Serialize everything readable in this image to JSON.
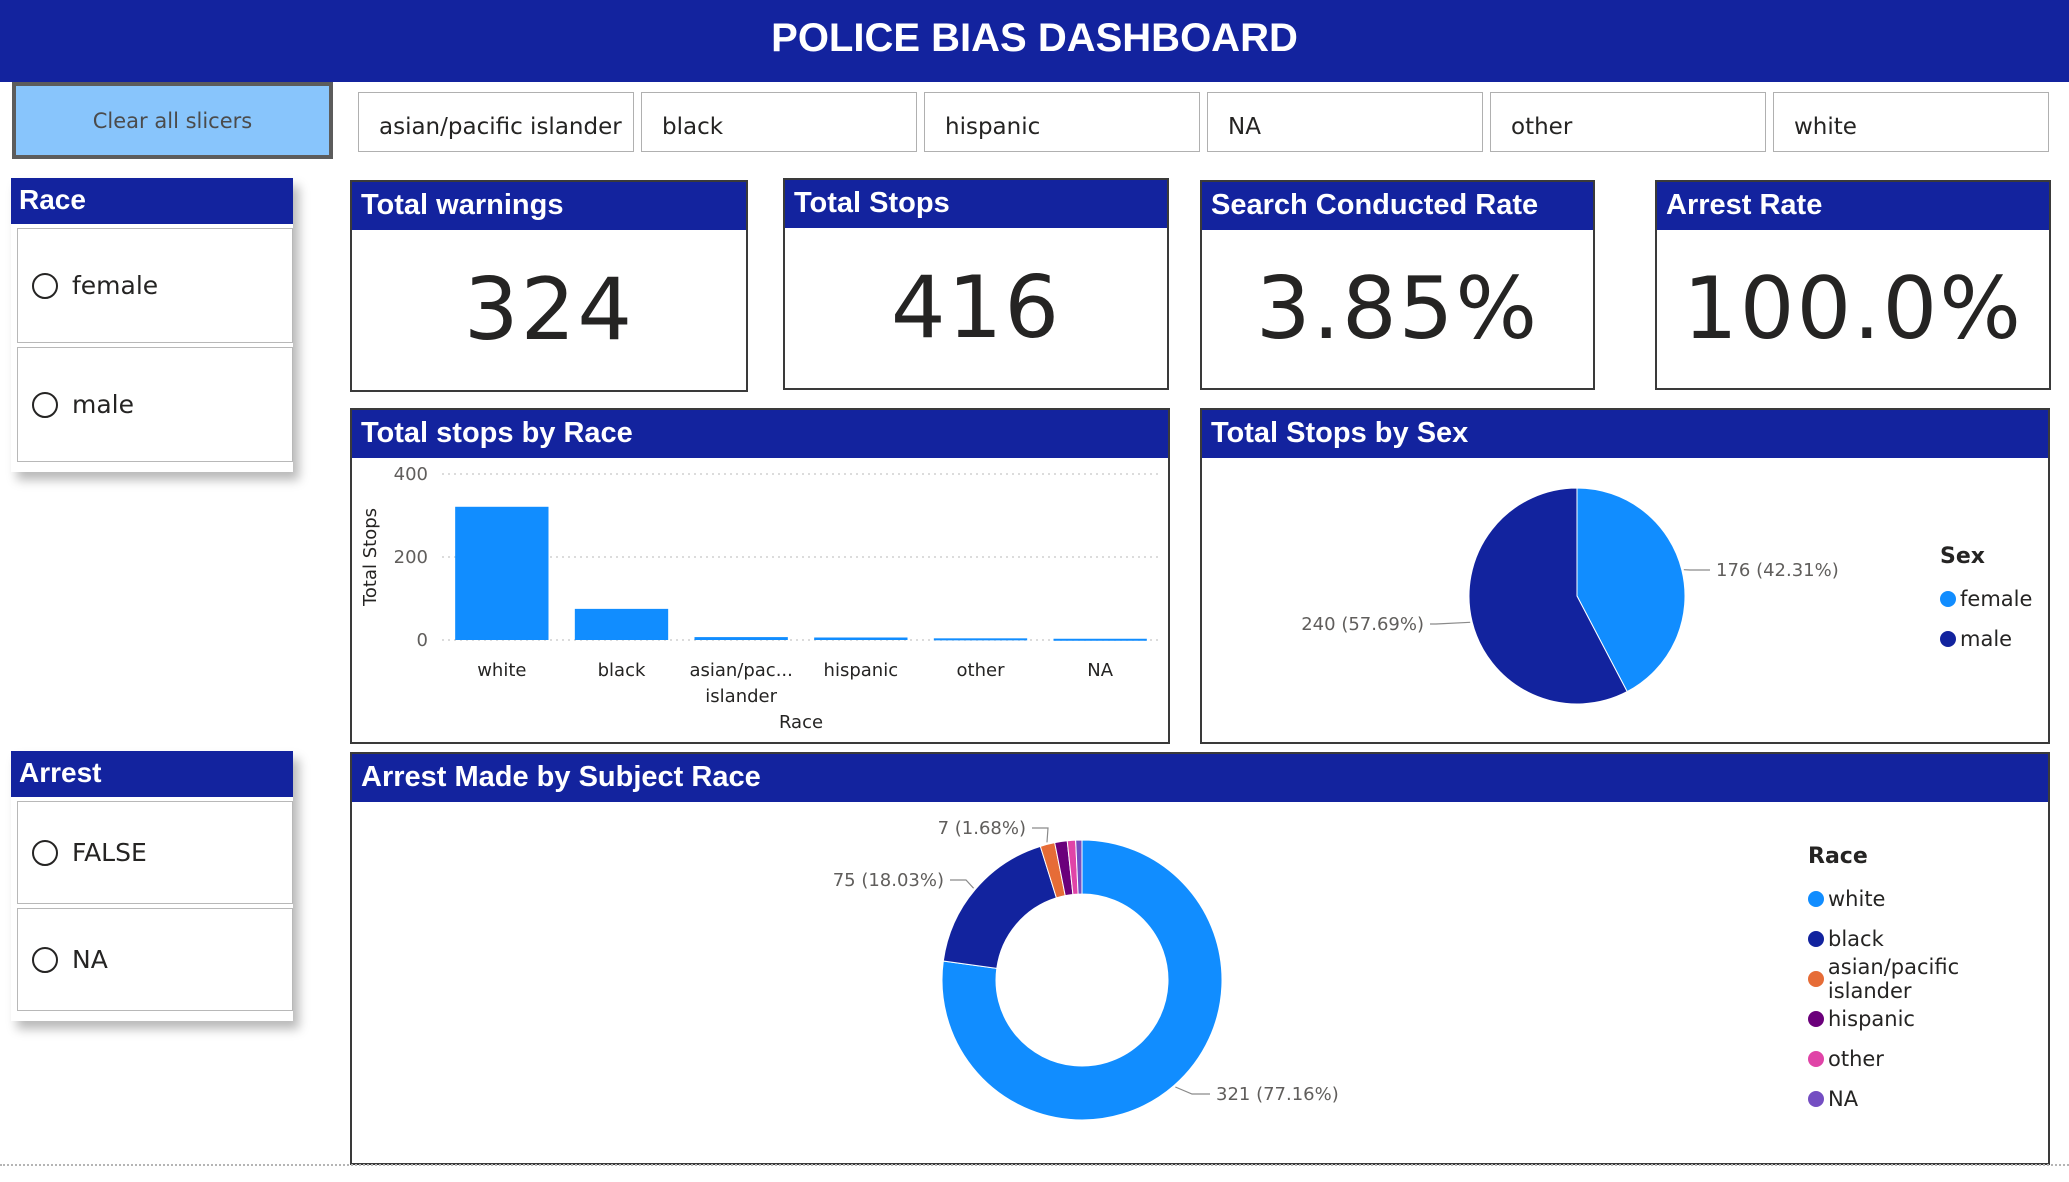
{
  "header": {
    "title": "POLICE BIAS DASHBOARD"
  },
  "clear_button": {
    "label": "Clear all slicers"
  },
  "race_filter": {
    "items": [
      "asian/pacific islander",
      "black",
      "hispanic",
      "NA",
      "other",
      "white"
    ]
  },
  "sex_slicer": {
    "title": "Race",
    "options": [
      "female",
      "male"
    ]
  },
  "arrest_slicer": {
    "title": "Arrest",
    "options": [
      "FALSE",
      "NA"
    ]
  },
  "kpis": {
    "warnings": {
      "title": "Total warnings",
      "value": "324"
    },
    "stops": {
      "title": "Total Stops",
      "value": "416"
    },
    "search_rate": {
      "title": "Search Conducted Rate",
      "value": "3.85%"
    },
    "arrest_rate": {
      "title": "Arrest Rate",
      "value": "100.0%"
    }
  },
  "colors": {
    "brand": "#13239e",
    "series_light": "#118dff",
    "series_dark": "#12239e",
    "orange": "#e66c37",
    "purple": "#6b007b",
    "pink": "#e044a7",
    "violet": "#744ec2"
  },
  "panels": {
    "race_bar": {
      "title": "Total stops by Race"
    },
    "sex_pie": {
      "title": "Total Stops by Sex"
    },
    "arrest_donut": {
      "title": "Arrest Made by Subject Race"
    }
  },
  "chart_data": [
    {
      "type": "bar",
      "title": "Total stops by Race",
      "xlabel": "Race",
      "ylabel": "Total Stops",
      "categories": [
        "white",
        "black",
        "asian/pac... islander",
        "hispanic",
        "other",
        "NA"
      ],
      "values": [
        321,
        75,
        7,
        6,
        4,
        3
      ],
      "yticks": [
        0,
        200,
        400
      ],
      "ylim": [
        0,
        400
      ],
      "grid": true,
      "color": "#118dff"
    },
    {
      "type": "pie",
      "title": "Total Stops by Sex",
      "legend_title": "Sex",
      "legend_position": "right",
      "slices": [
        {
          "label": "female",
          "value": 176,
          "data_label": "176 (42.31%)",
          "color": "#118dff"
        },
        {
          "label": "male",
          "value": 240,
          "data_label": "240 (57.69%)",
          "color": "#12239e"
        }
      ]
    },
    {
      "type": "pie",
      "donut": true,
      "title": "Arrest Made by Subject Race",
      "legend_title": "Race",
      "legend_position": "right",
      "slices": [
        {
          "label": "white",
          "value": 321,
          "data_label": "321 (77.16%)",
          "color": "#118dff"
        },
        {
          "label": "black",
          "value": 75,
          "data_label": "75 (18.03%)",
          "color": "#12239e"
        },
        {
          "label": "asian/pacific islander",
          "value": 7,
          "data_label": "7 (1.68%)",
          "color": "#e66c37"
        },
        {
          "label": "hispanic",
          "value": 6,
          "data_label": "",
          "color": "#6b007b"
        },
        {
          "label": "other",
          "value": 4,
          "data_label": "",
          "color": "#e044a7"
        },
        {
          "label": "NA",
          "value": 3,
          "data_label": "",
          "color": "#744ec2"
        }
      ]
    }
  ]
}
